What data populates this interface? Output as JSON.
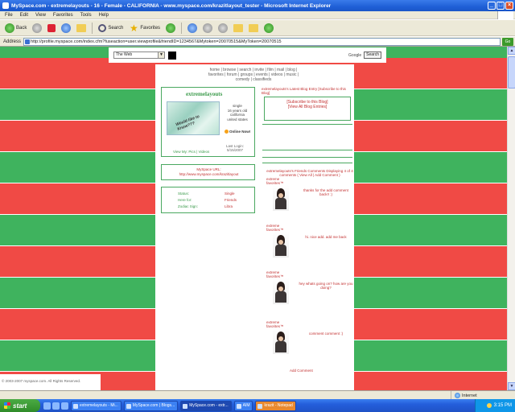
{
  "window": {
    "title": "MySpace.com - extremelayouts - 16 - Female - CALIFORNIA - www.myspace.com/krazitlayout_tester - Microsoft Internet Explorer"
  },
  "menu": [
    "File",
    "Edit",
    "View",
    "Favorites",
    "Tools",
    "Help"
  ],
  "toolbar": {
    "back": "Back",
    "search": "Search",
    "favorites": "Favorites"
  },
  "address": {
    "label": "Address",
    "url": "http://profile.myspace.com/index.cfm?fuseaction=user.viewprofile&friendID=1234567&Mytoken=20070515&MyToken=20070515"
  },
  "search": {
    "select_value": "The Web",
    "label": "Google",
    "button": "Search"
  },
  "nav": {
    "links": "home | browse | search | invite | film | mail | blog | favorites | forum | groups | events | videos | music | comedy | classifieds"
  },
  "profile": {
    "name": "extremelayouts",
    "pic_text": "Would like to Know???",
    "info": [
      "single",
      "16 years old",
      "california",
      "united states"
    ],
    "online": "Online Now!",
    "last_login": [
      "Last Login:",
      "5/15/2007"
    ],
    "view_link": "View My: Pics | Videos"
  },
  "blog": {
    "header": "extremelayouts's Latest Blog Entry [Subscribe to this Blog]",
    "subscribe": "[Subscribe to this Blog]",
    "view_all": "[View All Blog Entries]"
  },
  "url_box": {
    "label": "MySpace URL:",
    "url": "http://www.myspace.com/krazitlayout"
  },
  "interests": [
    {
      "label": "Status:",
      "value": "Single"
    },
    {
      "label": "Here for:",
      "value": "Friends"
    },
    {
      "label": "Zodiac Sign:",
      "value": "Libra"
    }
  ],
  "comments_head": "extremelayouts's Friends Comments Displaying 4 of 4 comments ( View All | Add Comment )",
  "comments": [
    {
      "name": "extreme favorites™",
      "text": "thanks for the add comment back!! :)"
    },
    {
      "name": "extreme favorites™",
      "text": "hi. nice add. add me back"
    },
    {
      "name": "extreme favorites™",
      "text": "hey whats going on? how are you doing?"
    },
    {
      "name": "extreme favorites™",
      "text": "comment comment :)"
    }
  ],
  "add_comment": "Add Comment",
  "footer": "© 2003-2007 myspace.com. All Rights Reserved.",
  "status": {
    "zone": "Internet"
  },
  "taskbar": {
    "start": "start",
    "tasks": [
      "extremelayouts - Mi...",
      "MySpace.com | Blogs...",
      "MySpace.com - extr...",
      "AIM",
      "krazit - Notepad"
    ],
    "clock": "3:15 PM"
  }
}
